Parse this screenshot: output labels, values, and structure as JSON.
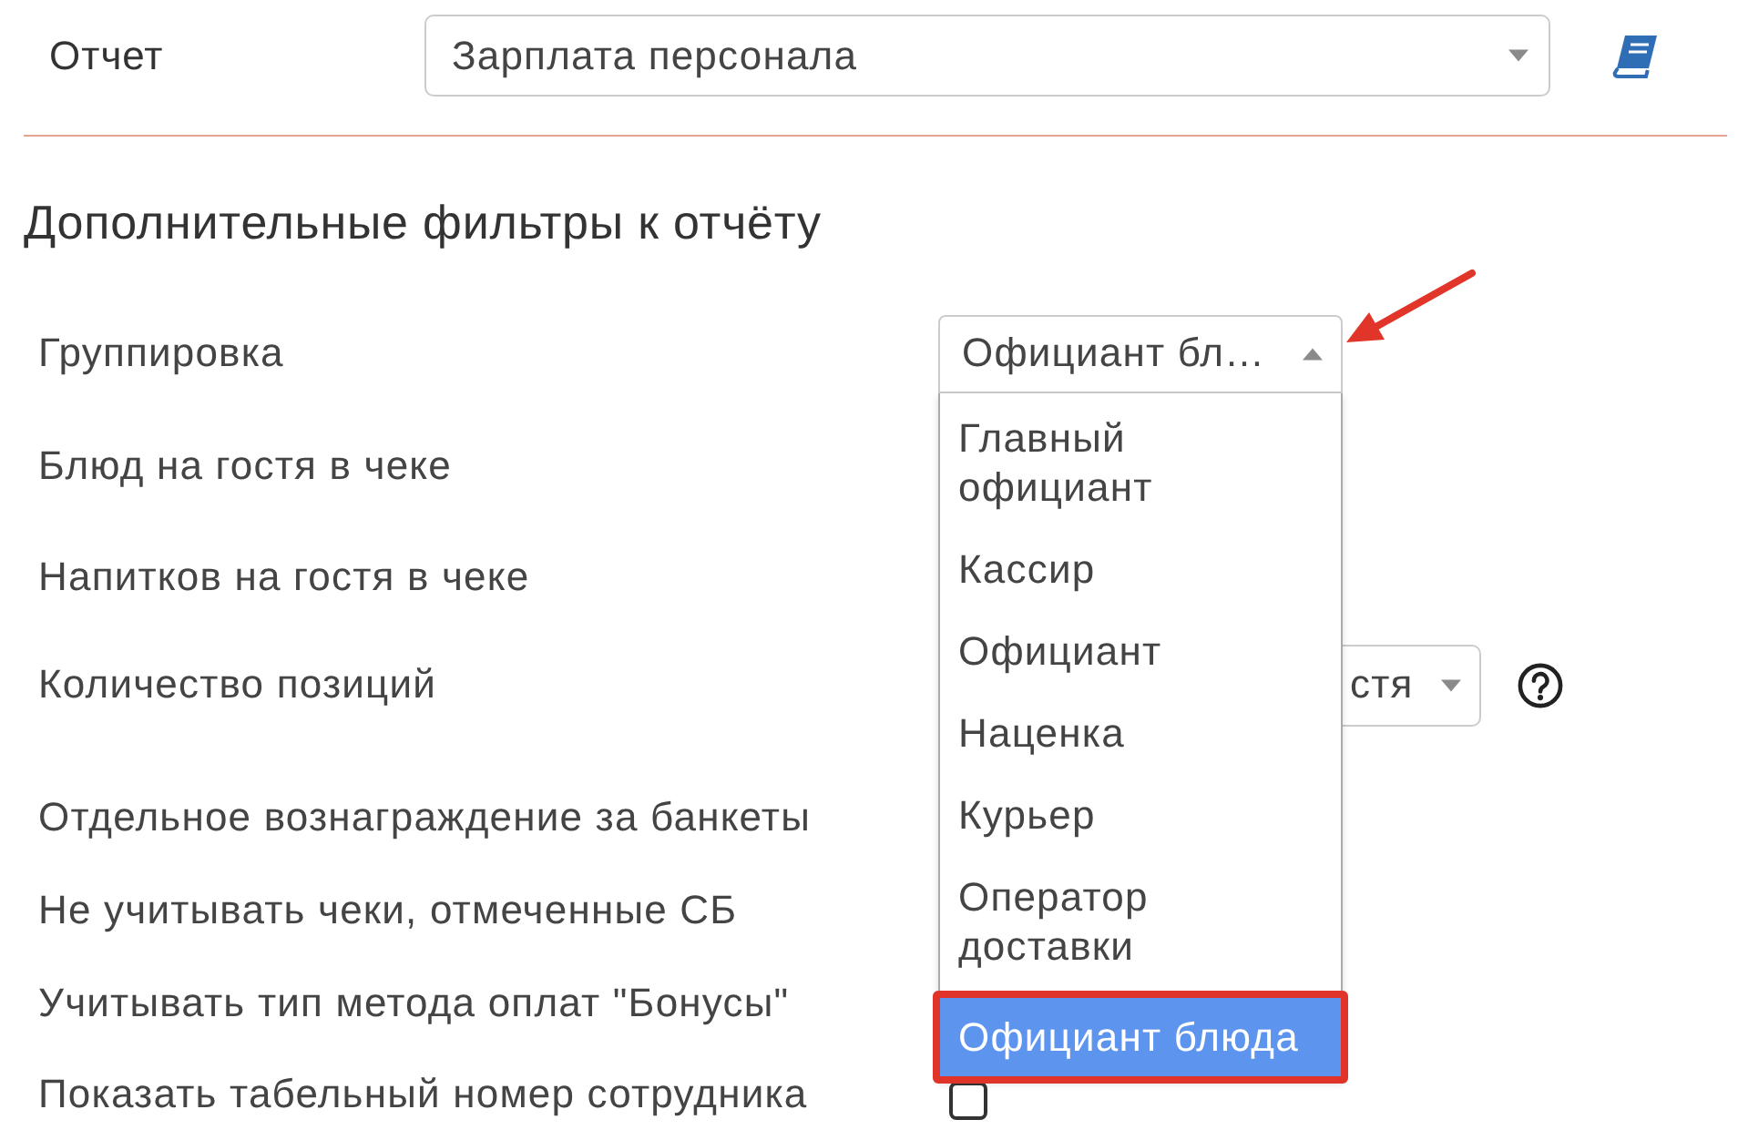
{
  "report": {
    "label": "Отчет",
    "value": "Зарплата персонала"
  },
  "section_title": "Дополнительные фильтры к отчёту",
  "filters": [
    {
      "label": "Группировка",
      "kind": "select",
      "value": "Официант бл…",
      "expanded": true,
      "options": [
        {
          "label": "Главный официант",
          "selected": false
        },
        {
          "label": "Кассир",
          "selected": false
        },
        {
          "label": "Официант",
          "selected": false
        },
        {
          "label": "Наценка",
          "selected": false
        },
        {
          "label": "Курьер",
          "selected": false
        },
        {
          "label": "Оператор доставки",
          "selected": false
        },
        {
          "label": "Официант блюда",
          "selected": true
        }
      ]
    },
    {
      "label": "Блюд на гостя в чеке"
    },
    {
      "label": "Напитков на гостя в чеке"
    },
    {
      "label": "Количество позиций",
      "kind": "select",
      "value": "стя",
      "expanded": false,
      "help": true
    },
    {
      "label": "Отдельное вознаграждение за банкеты"
    },
    {
      "label": "Не учитывать чеки, отмеченные СБ"
    },
    {
      "label": "Учитывать тип метода оплат \"Бонусы\""
    },
    {
      "label": "Показать табельный номер сотрудника",
      "kind": "checkbox",
      "checked": false
    }
  ]
}
